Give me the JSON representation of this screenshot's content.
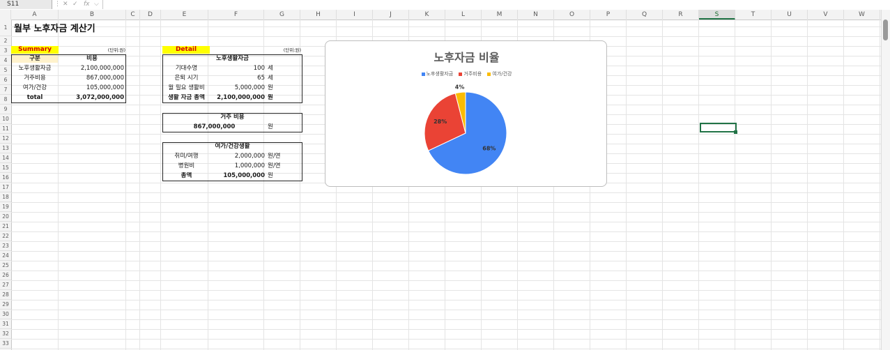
{
  "name_box": "S11",
  "formula_icons": {
    "cancel": "✕",
    "enter": "✓",
    "fx": "fx"
  },
  "columns": [
    "A",
    "B",
    "C",
    "D",
    "E",
    "F",
    "G",
    "H",
    "I",
    "J",
    "K",
    "L",
    "M",
    "N",
    "O",
    "P",
    "Q",
    "R",
    "S",
    "T",
    "U",
    "V",
    "W"
  ],
  "selected_column": "S",
  "rows": [
    "1",
    "2",
    "3",
    "4",
    "5",
    "6",
    "7",
    "8",
    "9",
    "10",
    "11",
    "12",
    "13",
    "14",
    "15",
    "16",
    "17",
    "18",
    "19",
    "20",
    "21",
    "22",
    "23",
    "24",
    "25",
    "26",
    "27",
    "28",
    "29",
    "30",
    "31",
    "32",
    "33"
  ],
  "sheet_title": "월부 노후자금 계산기",
  "summary": {
    "label": "Summary",
    "unit": "(단위:원)",
    "header": [
      "구분",
      "비용"
    ],
    "rows": [
      {
        "name": "노후생활자금",
        "value": "2,100,000,000"
      },
      {
        "name": "거주비용",
        "value": "867,000,000"
      },
      {
        "name": "여가/건강",
        "value": "105,000,000"
      }
    ],
    "total_label": "total",
    "total_value": "3,072,000,000"
  },
  "detail": {
    "label": "Detail",
    "unit": "(단위:원)",
    "living": {
      "title": "노후생활자금",
      "rows": [
        {
          "name": "기대수명",
          "value": "100",
          "unit": "세"
        },
        {
          "name": "은퇴 시기",
          "value": "65",
          "unit": "세"
        },
        {
          "name": "월 필요 생활비",
          "value": "5,000,000",
          "unit": "원"
        },
        {
          "name": "생활 자금 총액",
          "value": "2,100,000,000",
          "unit": "원"
        }
      ]
    },
    "housing": {
      "title": "거주 비용",
      "value": "867,000,000",
      "unit": "원"
    },
    "leisure": {
      "title": "여가/건강생활",
      "rows": [
        {
          "name": "취미/여행",
          "value": "2,000,000",
          "unit": "원/연"
        },
        {
          "name": "병원비",
          "value": "1,000,000",
          "unit": "원/연"
        },
        {
          "name": "총액",
          "value": "105,000,000",
          "unit": "원"
        }
      ]
    }
  },
  "chart_data": {
    "type": "pie",
    "title": "노후자금 비율",
    "legend_position": "top",
    "categories": [
      "노후생활자금",
      "거주비용",
      "여가/건강"
    ],
    "values": [
      68,
      28,
      4
    ],
    "labels": [
      "68%",
      "28%",
      "4%"
    ],
    "colors": [
      "#4285f4",
      "#ea4335",
      "#fbbc04"
    ]
  }
}
